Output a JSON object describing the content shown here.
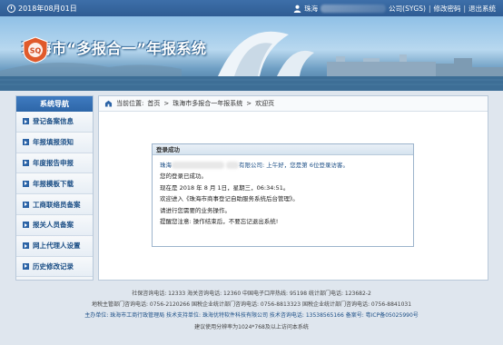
{
  "topbar": {
    "date": "2018年08月01日",
    "user_prefix": "珠海",
    "user_suffix": "公司(SYGS)",
    "change_password": "修改密码",
    "logout": "退出系统"
  },
  "banner": {
    "title": "珠海市“多报合一”年报系统",
    "emblem_text": "SQ"
  },
  "sidebar": {
    "title": "系统导航",
    "items": [
      {
        "label": "登记备案信息"
      },
      {
        "label": "年报填报须知"
      },
      {
        "label": "年度报告申报"
      },
      {
        "label": "年报模板下载"
      },
      {
        "label": "工商联络员备案"
      },
      {
        "label": "报关人员备案"
      },
      {
        "label": "网上代理人设置"
      },
      {
        "label": "历史修改记录"
      }
    ]
  },
  "breadcrumb": {
    "prefix": "当前位置:",
    "home": "首页",
    "arrow1": ">",
    "section": "珠海市多报合一年报系统",
    "arrow2": ">",
    "current": "欢迎页"
  },
  "dialog": {
    "title": "登录成功",
    "line1_prefix": "珠海",
    "line1_suffix": "有限公司: 上午好，您是第 6位登录访客。",
    "line2": "您的登录已成功。",
    "line3": "现在是 2018 年 8 月 1日，星期三，06:34:51。",
    "line4": "欢迎进入《珠海市商事登记自助服务系统后台管理》。",
    "line5": "请进行您需要的业务操作。",
    "line6": "提醒您注意: 操作结束后，不要忘记退出系统!"
  },
  "footer": {
    "line1": "社保咨询电话: 12333    海关咨询电话: 12360    中国电子口岸热线: 95198    统计部门电话: 123682-2",
    "line2": "地税主管部门咨询电话: 0756-2120266    国税企业统计部门咨询电话: 0756-8813323    国税企业统计部门咨询电话: 0756-8841031",
    "line3": "主办单位: 珠海市工商行政管理局    技术支持单位: 珠海优特软件科技有限公司    技术咨询电话: 13538565166    备案号: 粤ICP备05025990号",
    "line4": "建议使用分辨率为1024*768及以上访问本系统"
  }
}
